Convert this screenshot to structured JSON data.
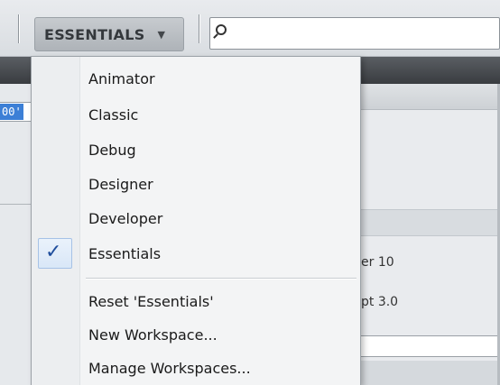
{
  "toolbar": {
    "workspace_label": "ESSENTIALS",
    "search_placeholder": ""
  },
  "background": {
    "left_input_value": "00'",
    "right_text_1": "er 10",
    "right_text_2": "pt 3.0"
  },
  "menu": {
    "items": [
      {
        "label": "Animator",
        "checked": false
      },
      {
        "label": "Classic",
        "checked": false
      },
      {
        "label": "Debug",
        "checked": false
      },
      {
        "label": "Designer",
        "checked": false
      },
      {
        "label": "Developer",
        "checked": false
      },
      {
        "label": "Essentials",
        "checked": true
      }
    ],
    "actions": [
      {
        "label": "Reset 'Essentials'"
      },
      {
        "label": "New Workspace..."
      },
      {
        "label": "Manage Workspaces..."
      }
    ]
  },
  "colors": {
    "check": "#1f4e9c",
    "selection": "#3c7fd6"
  }
}
